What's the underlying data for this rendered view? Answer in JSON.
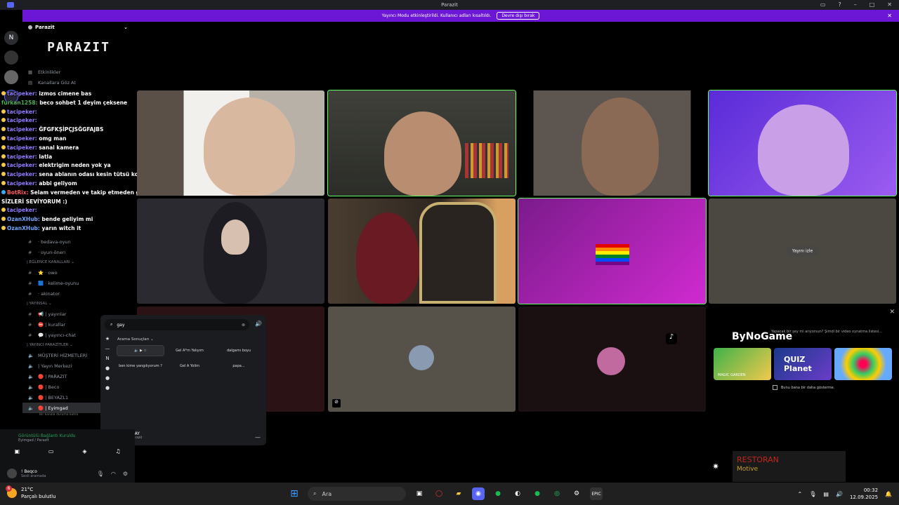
{
  "window": {
    "title": "Parazit"
  },
  "banner": {
    "text": "Yayıncı Modu etkinleştirildi. Kullanıcı adları kısaltıldı.",
    "button": "Devre dışı bırak"
  },
  "server": {
    "name": "Parazit",
    "banner": "PARAZIT"
  },
  "channels": [
    {
      "label": "Etkinlikler",
      "icon": "calendar-icon"
    },
    {
      "label": "Kanallara Göz At",
      "icon": "browse-icon"
    }
  ],
  "lower_channels": [
    {
      "type": "cat",
      "label": "| EĞLENCE KANALLARI ⌄"
    },
    {
      "type": "ch",
      "label": "⭐ · owo"
    },
    {
      "type": "ch",
      "label": "🟦 · kelime-oyunu"
    },
    {
      "type": "ch",
      "label": "· akinator"
    },
    {
      "type": "cat",
      "label": "| YAYINSAL ⌄"
    },
    {
      "type": "ch",
      "label": "📢 | yayınlar"
    },
    {
      "type": "ch",
      "label": "⛔ | kurallar"
    },
    {
      "type": "ch",
      "label": "💬 | yayıncı-chat"
    },
    {
      "type": "cat",
      "label": "| YAYINCI PARAZİTLER ⌄"
    },
    {
      "type": "v",
      "label": "MÜŞTERİ HİZMETLERİ"
    },
    {
      "type": "v",
      "label": "| Yayın Merkezi"
    },
    {
      "type": "v",
      "label": "🔴 | PARAZIT"
    },
    {
      "type": "v",
      "label": "🔴 | Beco"
    },
    {
      "type": "v",
      "label": "🔴 | BEYAZL1"
    },
    {
      "type": "v",
      "label": "🔴 | Eyimgad"
    }
  ],
  "upper_channels": [
    {
      "label": "· bedava-oyun"
    },
    {
      "label": "· oyun-önerı"
    }
  ],
  "chat": [
    {
      "user": "tacipeker:",
      "msg": "izmos cimene bas"
    },
    {
      "user": "furkan1258:",
      "msg": "beco sohbet 1 deyim çeksene"
    },
    {
      "user": "tacipeker:",
      "msg": ""
    },
    {
      "user": "tacipeker:",
      "msg": ""
    },
    {
      "user": "tacipeker:",
      "msg": "ĞFGFKŞİPÇJSĞGFAJBS"
    },
    {
      "user": "tacipeker:",
      "msg": "omg man"
    },
    {
      "user": "tacipeker:",
      "msg": "sanal kamera"
    },
    {
      "user": "tacipeker:",
      "msg": "latla"
    },
    {
      "user": "tacipeker:",
      "msg": "elektrigim neden yok ya"
    },
    {
      "user": "tacipeker:",
      "msg": "sena ablanın odası kesin tütsü kokuyo ya"
    },
    {
      "user": "tacipeker:",
      "msg": "abbi geliyom"
    },
    {
      "user": "BotRix:",
      "msg": "Selam vermeden ve takip etmeden geçmeyin SİZLERİ SEVİYORUM :)"
    },
    {
      "user": "tacipeker:",
      "msg": ""
    },
    {
      "user": "OzanXHub:",
      "msg": "bende geliyim mi"
    },
    {
      "user": "OzanXHub:",
      "msg": "yarın witch it"
    }
  ],
  "tiles": {
    "watch_label": "Yayını izle"
  },
  "soundboard": {
    "query": "gay",
    "results_header": "Arama Sonuçları ⌄",
    "sounds": [
      "",
      "Gel A*m Yalıyım",
      "dalgamı boyu",
      "ben kime yangılıyorum ?",
      "Gel A Yolim",
      "papa..."
    ],
    "footer_name": "GAY",
    "footer_sub": "Parazit"
  },
  "voice": {
    "status": "Görüntülü Bağlantı Kuruldu",
    "channel": "Eyimgad / Parazit",
    "connected_hint": "Bir kanala duruma katıla"
  },
  "user": {
    "name": "! Beqco",
    "status": "Sesli aramada"
  },
  "ad": {
    "brand": "ByNoGame",
    "question": "Yapacak bir şey mi arıyorsun? Şimdi bir video oynatma listesi...",
    "games": [
      "MAGIC GARDEN",
      "QUIZ Planet",
      ""
    ],
    "dont_show": "Bunu bana bir daha gösterme."
  },
  "restoran": {
    "title": "RESTORAN",
    "sub": "Motive"
  },
  "taskbar": {
    "temp": "21°C",
    "weather": "Parçalı bulutlu",
    "badge": "6",
    "search": "Ara",
    "time": "00:32",
    "date": "12.09.2025"
  }
}
